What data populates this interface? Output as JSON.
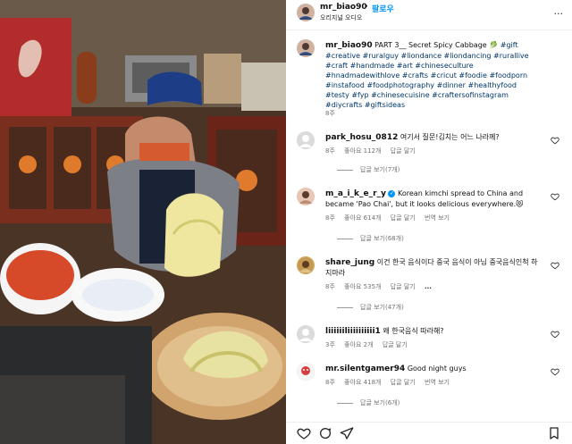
{
  "header": {
    "username": "mr_biao90",
    "dot": "•",
    "follow_label": "팔로우",
    "subtitle": "오리지널 오디오",
    "more_label": "..."
  },
  "caption": {
    "username": "mr_biao90",
    "title_text": "PART 3__ Secret Spicy Cabbage 🥬",
    "tags": "#gift #creative #ruralguy #liondance #liondancing #rurallive #craft #handmade #art #chineseculture #hnadmadewithlove #crafts #cricut #foodie #foodporn #instafood #foodphotography #dinner #healthyfood #testy #fyp #chinesecuisine #craftersofinstagram #diycrafts #giftsideas",
    "age": "8주"
  },
  "comments": [
    {
      "username": "park_hosu_0812",
      "text": " 여기서 질문!김치는 어느 나라께?",
      "age": "8주",
      "likes": "좋아요 112개",
      "reply": "답글 달기",
      "translate": "",
      "more": "",
      "view_replies": "답글 보기(7개)"
    },
    {
      "username": "m_a_i_k_e_r_y",
      "verified": "✓",
      "text": " Korean kimchi spread to China and became 'Pao Chai', but it looks delicious everywhere.😻",
      "age": "8주",
      "likes": "좋아요 614개",
      "reply": "답글 달기",
      "translate": "번역 보기",
      "more": "",
      "view_replies": "답글 보기(68개)"
    },
    {
      "username": "share_jung",
      "text": " 이건 한국 음식이다 중국 음식이 아님 중국음식인척 하지마라",
      "age": "8주",
      "likes": "좋아요 535개",
      "reply": "답글 달기",
      "translate": "",
      "more": "...",
      "view_replies": "답글 보기(47개)"
    },
    {
      "username": "liiiiiiliiiiiiiiii1",
      "text": " 왜 한국음식 따라해?",
      "age": "3주",
      "likes": "좋아요 2개",
      "reply": "답글 달기",
      "translate": "",
      "more": "",
      "view_replies": ""
    },
    {
      "username": "mr.silentgamer94",
      "text": " Good night guys",
      "age": "8주",
      "likes": "좋아요 418개",
      "reply": "답글 달기",
      "translate": "번역 보기",
      "more": "",
      "view_replies": "답글 보기(6개)"
    }
  ],
  "icons": {
    "like": "heart-icon",
    "comment": "comment-icon",
    "share": "share-icon",
    "save": "bookmark-icon"
  },
  "colors": {
    "link": "#00376b",
    "follow": "#0095f6",
    "muted": "#737373"
  }
}
